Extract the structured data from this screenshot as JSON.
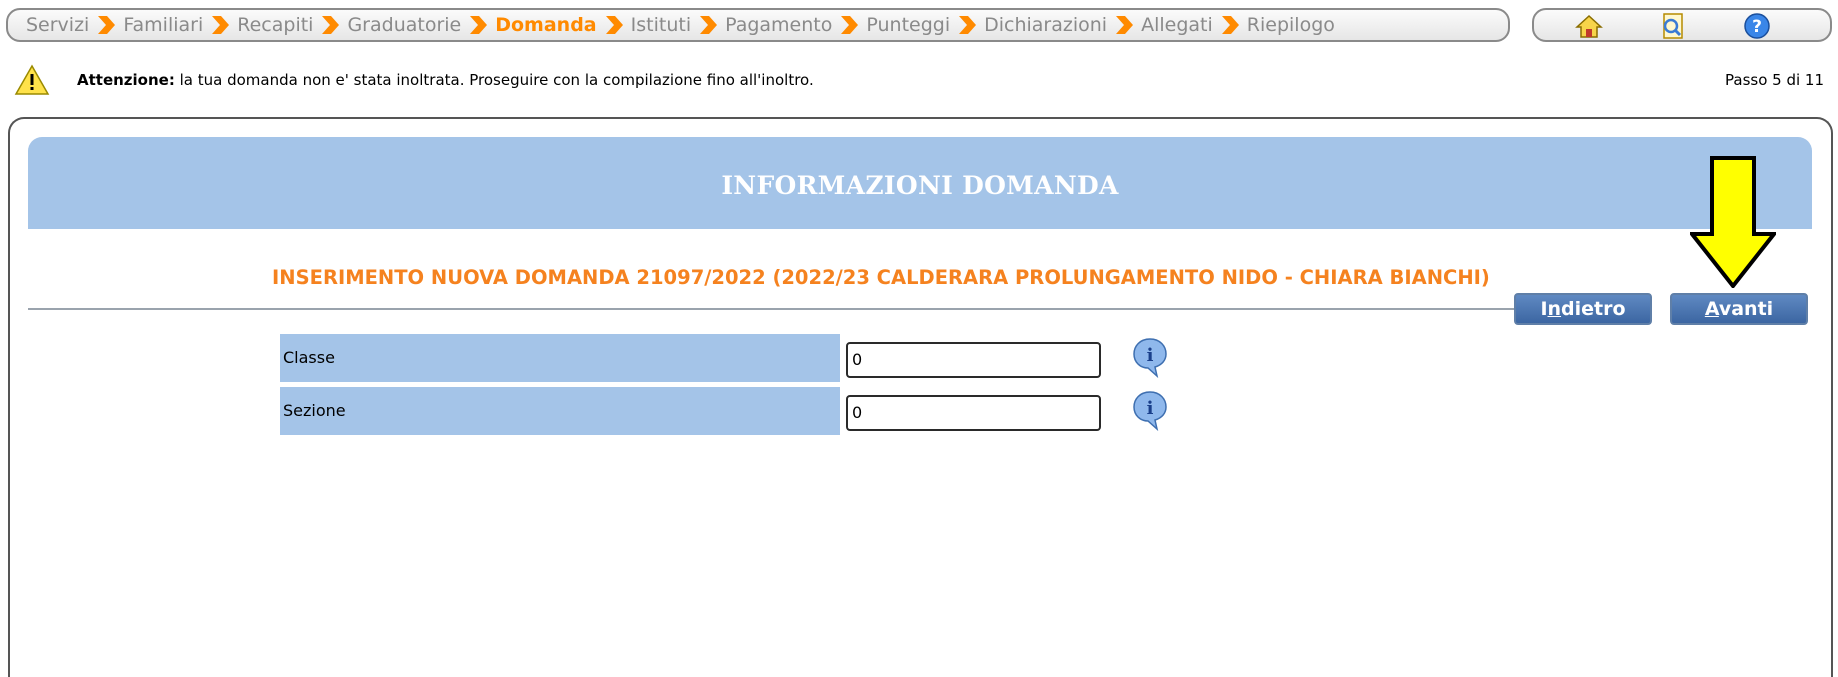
{
  "steps": [
    {
      "label": "Servizi",
      "active": false
    },
    {
      "label": "Familiari",
      "active": false
    },
    {
      "label": "Recapiti",
      "active": false
    },
    {
      "label": "Graduatorie",
      "active": false
    },
    {
      "label": "Domanda",
      "active": true
    },
    {
      "label": "Istituti",
      "active": false
    },
    {
      "label": "Pagamento",
      "active": false
    },
    {
      "label": "Punteggi",
      "active": false
    },
    {
      "label": "Dichiarazioni",
      "active": false
    },
    {
      "label": "Allegati",
      "active": false
    },
    {
      "label": "Riepilogo",
      "active": false
    }
  ],
  "toolbar": {
    "icons": [
      "home-icon",
      "search-doc-icon",
      "help-icon"
    ]
  },
  "warning": {
    "bold": "Attenzione:",
    "text": " la tua domanda non e' stata inoltrata. Proseguire con la compilazione fino all'inoltro.",
    "step_counter": "Passo 5 di 11"
  },
  "panel": {
    "title": "INFORMAZIONI DOMANDA",
    "subtitle": "INSERIMENTO NUOVA DOMANDA 21097/2022 (2022/23 CALDERARA PROLUNGAMENTO NIDO - CHIARA BIANCHI)"
  },
  "buttons": {
    "back": "Indietro",
    "next": "Avanti"
  },
  "form": {
    "fields": [
      {
        "label": "Classe",
        "value": "0"
      },
      {
        "label": "Sezione",
        "value": "0"
      }
    ]
  },
  "colors": {
    "header_blue": "#a4c4e8",
    "accent_orange": "#f5821f",
    "arrow_yellow": "#ffff00"
  }
}
